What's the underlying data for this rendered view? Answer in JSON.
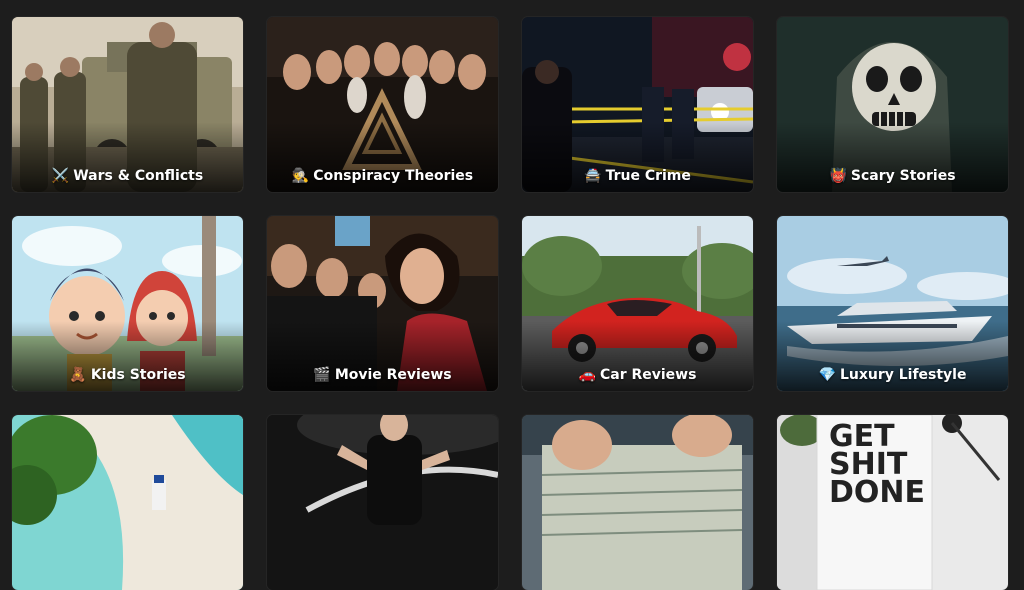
{
  "categories": [
    {
      "icon": "⚔️",
      "icon_name": "crossed-swords-icon",
      "label": "Wars & Conflicts"
    },
    {
      "icon": "🕵️",
      "icon_name": "detective-icon",
      "label": "Conspiracy Theories"
    },
    {
      "icon": "🚔",
      "icon_name": "police-car-icon",
      "label": "True Crime"
    },
    {
      "icon": "👹",
      "icon_name": "ogre-icon",
      "label": "Scary Stories"
    },
    {
      "icon": "🧸",
      "icon_name": "teddy-bear-icon",
      "label": "Kids Stories"
    },
    {
      "icon": "🎬",
      "icon_name": "clapper-board-icon",
      "label": "Movie Reviews"
    },
    {
      "icon": "🚗",
      "icon_name": "car-icon",
      "label": "Car Reviews"
    },
    {
      "icon": "💎",
      "icon_name": "gem-icon",
      "label": "Luxury Lifestyle"
    },
    {
      "icon": "",
      "icon_name": "",
      "label": ""
    },
    {
      "icon": "",
      "icon_name": "",
      "label": ""
    },
    {
      "icon": "",
      "icon_name": "",
      "label": ""
    },
    {
      "icon": "",
      "icon_name": "",
      "label": ""
    }
  ],
  "poster_text": {
    "line1": "GET",
    "line2": "SHIT",
    "line3": "DONE"
  }
}
